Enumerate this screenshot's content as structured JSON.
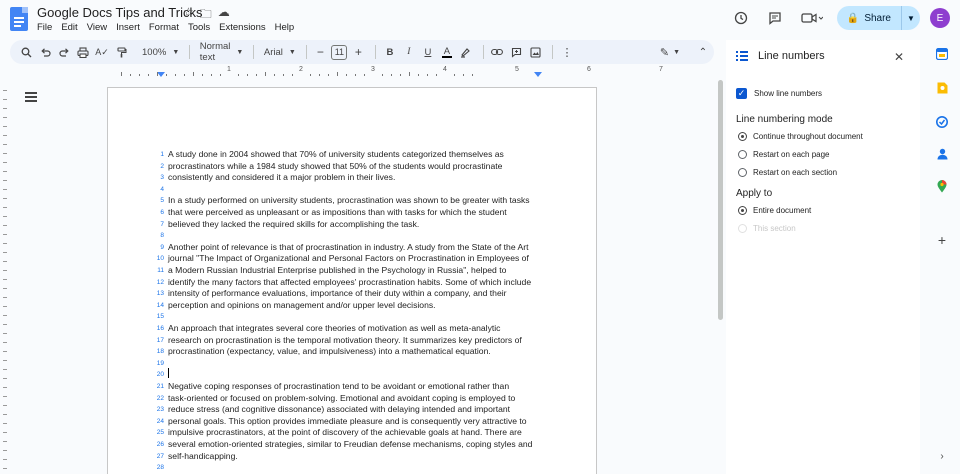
{
  "header": {
    "doc_title": "Google Docs Tips and Tricks",
    "menu": [
      "File",
      "Edit",
      "View",
      "Insert",
      "Format",
      "Tools",
      "Extensions",
      "Help"
    ],
    "share_label": "Share",
    "avatar_initial": "E"
  },
  "toolbar": {
    "zoom": "100%",
    "style": "Normal text",
    "font": "Arial",
    "font_size": "11"
  },
  "ruler": {
    "numbers": [
      "1",
      "2",
      "3",
      "4",
      "5",
      "6",
      "7"
    ]
  },
  "document": {
    "lines": [
      {
        "n": "1",
        "t": "A study done in 2004 showed that 70% of university students categorized themselves as"
      },
      {
        "n": "2",
        "t": "procrastinators while a 1984 study showed that 50% of the students would procrastinate"
      },
      {
        "n": "3",
        "t": "consistently and considered it a major problem in their lives."
      },
      {
        "n": "4",
        "t": ""
      },
      {
        "n": "5",
        "t": "In a study performed on university students, procrastination was shown to be greater with tasks"
      },
      {
        "n": "6",
        "t": "that were perceived as unpleasant or as impositions than with tasks for which the student"
      },
      {
        "n": "7",
        "t": "believed they lacked the required skills for accomplishing the task."
      },
      {
        "n": "8",
        "t": ""
      },
      {
        "n": "9",
        "t": "Another point of relevance is that of procrastination in industry. A study from the State of the Art"
      },
      {
        "n": "10",
        "t": "journal \"The Impact of Organizational and Personal Factors on Procrastination in Employees of"
      },
      {
        "n": "11",
        "t": "a Modern Russian Industrial Enterprise published in the Psychology in Russia\", helped to"
      },
      {
        "n": "12",
        "t": "identify the many factors that affected employees' procrastination habits. Some of which include"
      },
      {
        "n": "13",
        "t": "intensity of performance evaluations, importance of their duty within a company, and their"
      },
      {
        "n": "14",
        "t": "perception and opinions on management and/or upper level decisions."
      },
      {
        "n": "15",
        "t": ""
      },
      {
        "n": "16",
        "t": "An approach that integrates several core theories of motivation as well as meta-analytic"
      },
      {
        "n": "17",
        "t": "research on procrastination is the temporal motivation theory. It summarizes key predictors of"
      },
      {
        "n": "18",
        "t": "procrastination (expectancy, value, and impulsiveness) into a mathematical equation."
      },
      {
        "n": "19",
        "t": ""
      },
      {
        "n": "20",
        "t": ""
      },
      {
        "n": "21",
        "t": "Negative coping responses of procrastination tend to be avoidant or emotional rather than"
      },
      {
        "n": "22",
        "t": "task-oriented or focused on problem-solving. Emotional and avoidant coping is employed to"
      },
      {
        "n": "23",
        "t": "reduce stress (and cognitive dissonance) associated with delaying intended and important"
      },
      {
        "n": "24",
        "t": "personal goals. This option provides immediate pleasure and is consequently very attractive to"
      },
      {
        "n": "25",
        "t": "impulsive procrastinators, at the point of discovery of the achievable goals at hand. There are"
      },
      {
        "n": "26",
        "t": "several emotion-oriented strategies, similar to Freudian defense mechanisms, coping styles and"
      },
      {
        "n": "27",
        "t": "self-handicapping."
      },
      {
        "n": "28",
        "t": ""
      }
    ]
  },
  "panel": {
    "title": "Line numbers",
    "show_label": "Show line numbers",
    "mode_heading": "Line numbering mode",
    "mode_options": [
      "Continue throughout document",
      "Restart on each page",
      "Restart on each section"
    ],
    "apply_heading": "Apply to",
    "apply_options": [
      "Entire document",
      "This section"
    ]
  },
  "colors": {
    "accent": "#0b57d0",
    "line_number": "#1a73e8",
    "share_bg": "#c2e7ff",
    "avatar": "#8e3ecf"
  }
}
